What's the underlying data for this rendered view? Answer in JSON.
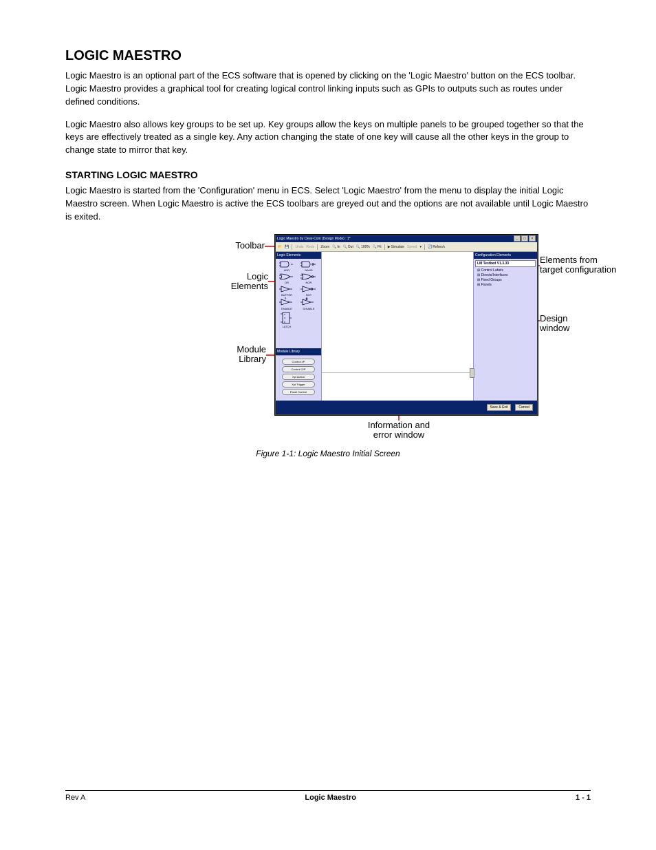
{
  "sectionTitle": "LOGIC MAESTRO",
  "para1": "Logic Maestro is an optional part of the ECS software that is opened by clicking on the 'Logic Maestro' button on the ECS toolbar. Logic Maestro provides a graphical tool for creating logical control linking inputs such as GPIs to outputs such as routes under defined conditions.",
  "para2": "Logic Maestro also allows key groups to be set up. Key groups allow the keys on multiple panels to be grouped together so that the keys are effectively treated as a single key. Any action changing the state of one key will cause all the other keys in the group to change state to mirror that key.",
  "subhead": "STARTING LOGIC MAESTRO",
  "para3": "Logic Maestro is started from the 'Configuration' menu in ECS. Select 'Logic Maestro' from the menu to display the initial Logic Maestro screen. When Logic Maestro is active the ECS toolbars are greyed out and the options are not available until Logic Maestro is exited.",
  "appTitle": "Logic Maestro by Clear-Com (Design Mode) : 1*",
  "toolbar": {
    "undo": "Undo",
    "redo": "Redo",
    "zoom": "Zoom",
    "in": "In",
    "out": "Out",
    "pct": "100%",
    "fit": "Fit",
    "simulate": "Simulate",
    "speed": "Speed",
    "refresh": "Refresh"
  },
  "logicElementsHdr": "Logic Elements",
  "gates": {
    "and": "AND",
    "nand": "NAND",
    "or": "OR",
    "nor": "NOR",
    "buffer": "BUFFER",
    "not": "NOT",
    "enable": "ENABLE",
    "disable": "DISABLE",
    "latch": "LATCH"
  },
  "moduleLibraryHdr": "Module Library",
  "modules": [
    "Control I/P",
    "Control O/P",
    "Xpt Action",
    "Xpt Trigger",
    "Panel Control"
  ],
  "configElementsHdr": "Configuration Elements",
  "configTitle": "LM Testbed V1.3.33",
  "configItems": [
    "Control Labels",
    "Directs/Interfaces",
    "Fixed Groups",
    "Panels"
  ],
  "saveExit": "Save & Exit",
  "cancel": "Cancel",
  "callouts": {
    "toolbar": "Toolbar",
    "logic": "Logic Elements",
    "module": "Module Library",
    "elements1": "Elements from",
    "elements2": "target configuration",
    "design1": "Design",
    "design2": "window",
    "info1": "Information and",
    "info2": "error window"
  },
  "caption": "Figure 1-1: Logic Maestro Initial Screen",
  "footer": {
    "left": "Rev A",
    "center": "Logic Maestro",
    "right": "1 - 1"
  }
}
